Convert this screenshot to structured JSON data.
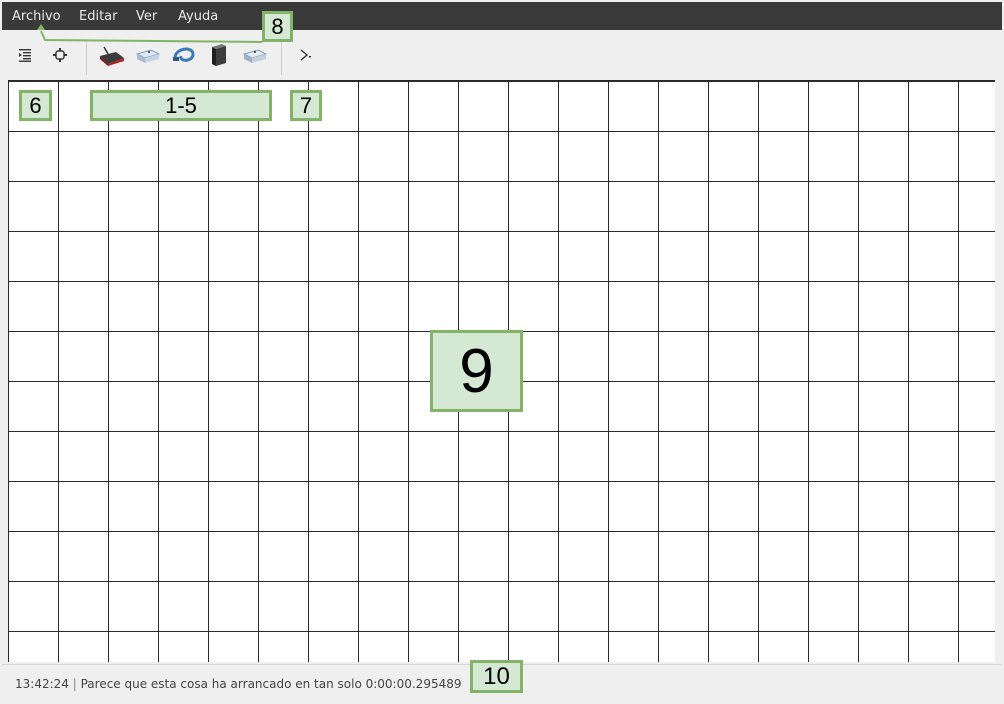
{
  "menubar": {
    "items": [
      "Archivo",
      "Editar",
      "Ver",
      "Ayuda"
    ]
  },
  "toolbar": {
    "buttons": [
      "hierarchy-icon",
      "device-settings-icon",
      "router-icon",
      "switch-icon",
      "cable-icon",
      "server-icon",
      "hub-icon",
      "terminal-icon"
    ]
  },
  "status": {
    "time": "13:42:24",
    "message": "Parece que esta cosa ha arrancado en tan solo 0:00:00.295489"
  },
  "callouts": {
    "c6": "6",
    "c15": "1-5",
    "c7": "7",
    "c8": "8",
    "c9": "9",
    "c10": "10"
  },
  "colors": {
    "menubar_bg": "#3a3a3a",
    "callout_fill": "#d5e8d4",
    "callout_border": "#82b366",
    "grid_line": "#2b2b2b"
  }
}
